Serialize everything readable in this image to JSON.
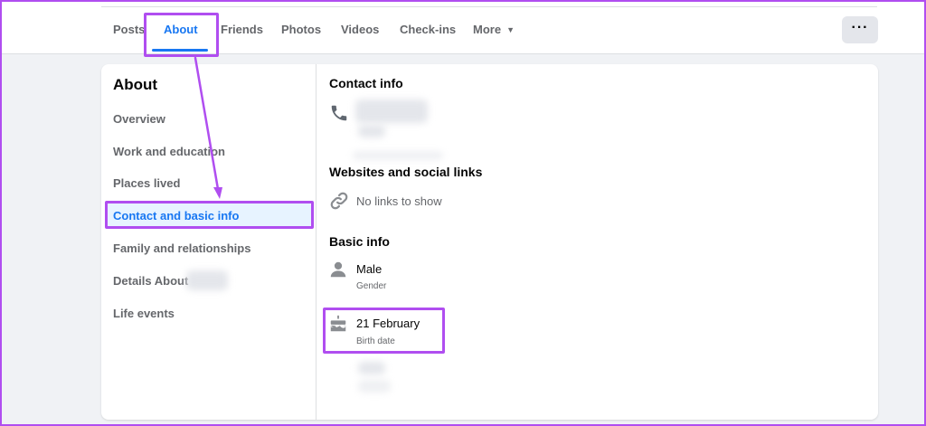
{
  "tabs": [
    {
      "label": "Posts"
    },
    {
      "label": "About"
    },
    {
      "label": "Friends"
    },
    {
      "label": "Photos"
    },
    {
      "label": "Videos"
    },
    {
      "label": "Check-ins"
    },
    {
      "label": "More"
    }
  ],
  "more_button_label": "···",
  "sidebar": {
    "heading": "About",
    "items": [
      {
        "label": "Overview"
      },
      {
        "label": "Work and education"
      },
      {
        "label": "Places lived"
      },
      {
        "label": "Contact and basic info"
      },
      {
        "label": "Family and relationships"
      },
      {
        "label": "Details About"
      },
      {
        "label": "Life events"
      }
    ]
  },
  "content": {
    "contact_title": "Contact info",
    "websites_title": "Websites and social links",
    "no_links": "No links to show",
    "basic_title": "Basic info",
    "gender_value": "Male",
    "gender_label": "Gender",
    "birth_value": "21 February",
    "birth_label": "Birth date"
  },
  "colors": {
    "accent": "#1877f2",
    "annotation": "#b04ef0"
  }
}
